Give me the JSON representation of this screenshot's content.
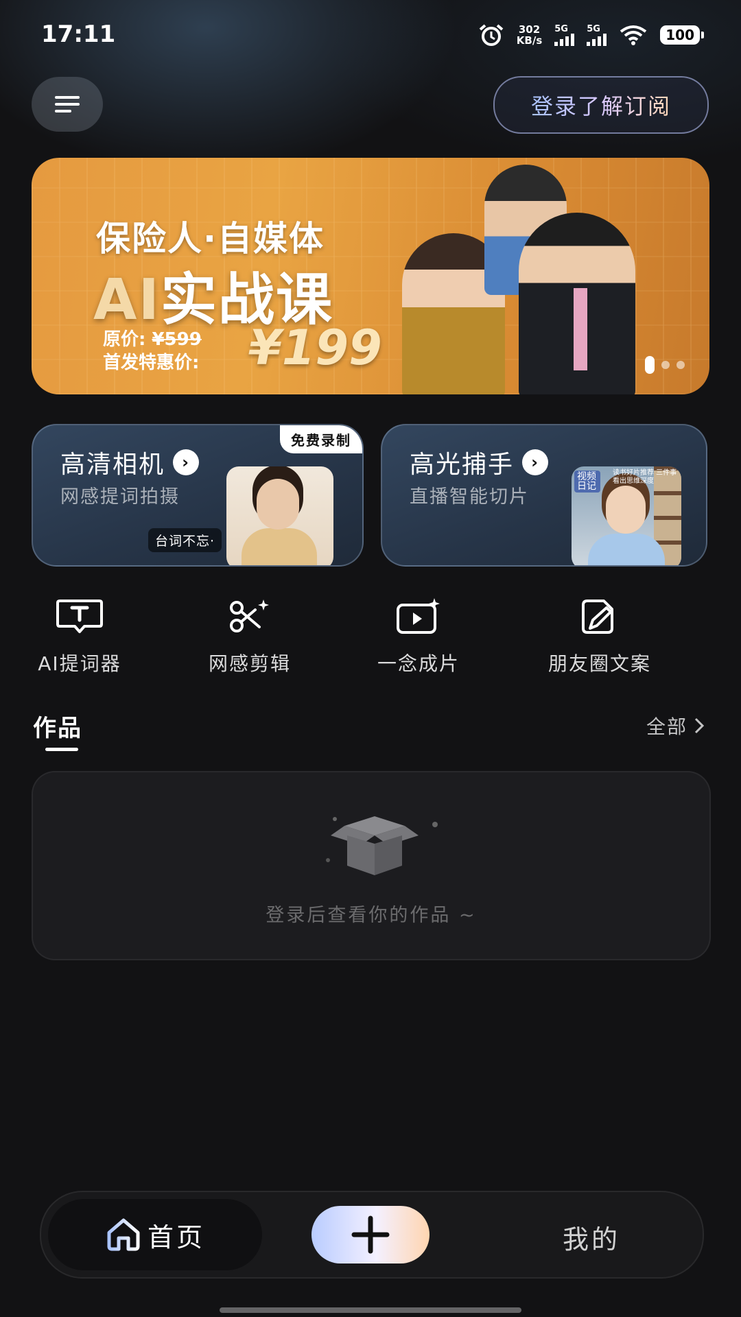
{
  "status_bar": {
    "time": "17:11",
    "net_speed_value": "302",
    "net_speed_unit": "KB/s",
    "sim1_label": "5G",
    "sim2_label": "5G",
    "battery": "100"
  },
  "header": {
    "login_label": "登录了解订阅",
    "menu_icon": "hamburger-icon"
  },
  "banner": {
    "title_line1": "保险人·自媒体",
    "title_ai": "AI",
    "title_line2_rest": "实战课",
    "original_price_label": "原价:",
    "original_price": "¥599",
    "promo_label": "首发特惠价:",
    "promo_price": "¥199",
    "carousel_total": 3,
    "carousel_active": 1
  },
  "feature_cards": [
    {
      "title": "高清相机",
      "subtitle": "网感提词拍摄",
      "badge": "免费录制",
      "caption": "台词不忘·"
    },
    {
      "title": "高光捕手",
      "subtitle": "直播智能切片",
      "thumb_tag1": "视频日记",
      "thumb_tag2": "读书好片推荐 三件事 看出思维深度"
    }
  ],
  "tools": [
    {
      "label": "AI提词器",
      "icon": "teleprompter-icon"
    },
    {
      "label": "网感剪辑",
      "icon": "scissors-icon"
    },
    {
      "label": "一念成片",
      "icon": "video-sparkle-icon"
    },
    {
      "label": "朋友圈文案",
      "icon": "pen-doc-icon"
    }
  ],
  "works": {
    "title": "作品",
    "all_label": "全部",
    "empty_text": "登录后查看你的作品 ~"
  },
  "bottom_nav": {
    "home_label": "首页",
    "mine_label": "我的"
  }
}
